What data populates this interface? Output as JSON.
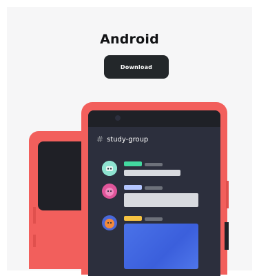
{
  "header": {
    "title": "Android",
    "download_label": "Download"
  },
  "phone": {
    "channel_hash": "#",
    "channel_name": "study-group"
  },
  "colors": {
    "card_bg": "#f6f6f7",
    "button_bg": "#23272a",
    "phone_body": "#f25f5c",
    "screen_bg": "#2c2f3d",
    "accent_green": "#43d9a0",
    "accent_blue": "#b4c6ff",
    "accent_yellow": "#f6c342",
    "image_blue": "#4a72e8"
  },
  "icons": [
    "hash-icon",
    "robot-avatar-icon",
    "pink-avatar-icon",
    "fox-avatar-icon"
  ]
}
